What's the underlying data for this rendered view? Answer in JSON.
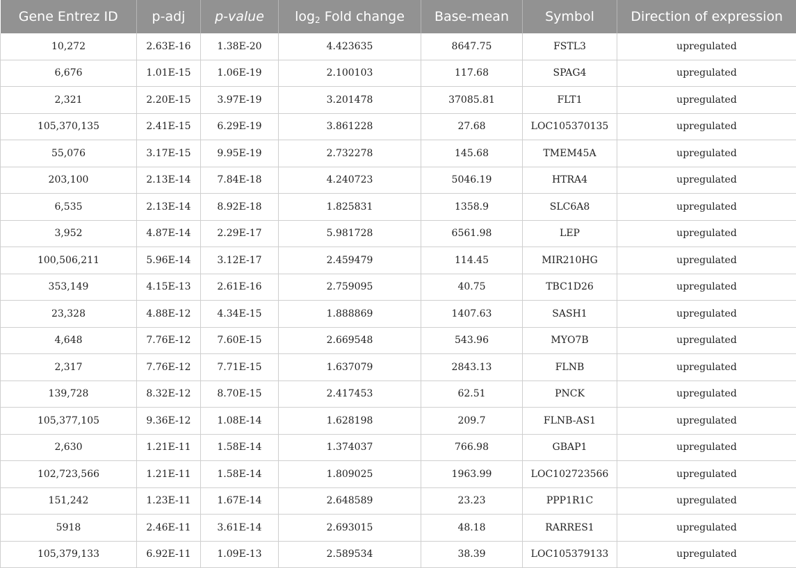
{
  "table": {
    "headers": {
      "gene_id": "Gene Entrez ID",
      "padj": "p-adj",
      "pvalue": "p-value",
      "log_prefix": "log",
      "log_sub": "2",
      "log_suffix": " Fold change",
      "basemean": "Base-mean",
      "symbol": "Symbol",
      "direction": "Direction of expression"
    },
    "rows": [
      [
        "10,272",
        "2.63E-16",
        "1.38E-20",
        "4.423635",
        "8647.75",
        "FSTL3",
        "upregulated"
      ],
      [
        "6,676",
        "1.01E-15",
        "1.06E-19",
        "2.100103",
        "117.68",
        "SPAG4",
        "upregulated"
      ],
      [
        "2,321",
        "2.20E-15",
        "3.97E-19",
        "3.201478",
        "37085.81",
        "FLT1",
        "upregulated"
      ],
      [
        "105,370,135",
        "2.41E-15",
        "6.29E-19",
        "3.861228",
        "27.68",
        "LOC105370135",
        "upregulated"
      ],
      [
        "55,076",
        "3.17E-15",
        "9.95E-19",
        "2.732278",
        "145.68",
        "TMEM45A",
        "upregulated"
      ],
      [
        "203,100",
        "2.13E-14",
        "7.84E-18",
        "4.240723",
        "5046.19",
        "HTRA4",
        "upregulated"
      ],
      [
        "6,535",
        "2.13E-14",
        "8.92E-18",
        "1.825831",
        "1358.9",
        "SLC6A8",
        "upregulated"
      ],
      [
        "3,952",
        "4.87E-14",
        "2.29E-17",
        "5.981728",
        "6561.98",
        "LEP",
        "upregulated"
      ],
      [
        "100,506,211",
        "5.96E-14",
        "3.12E-17",
        "2.459479",
        "114.45",
        "MIR210HG",
        "upregulated"
      ],
      [
        "353,149",
        "4.15E-13",
        "2.61E-16",
        "2.759095",
        "40.75",
        "TBC1D26",
        "upregulated"
      ],
      [
        "23,328",
        "4.88E-12",
        "4.34E-15",
        "1.888869",
        "1407.63",
        "SASH1",
        "upregulated"
      ],
      [
        "4,648",
        "7.76E-12",
        "7.60E-15",
        "2.669548",
        "543.96",
        "MYO7B",
        "upregulated"
      ],
      [
        "2,317",
        "7.76E-12",
        "7.71E-15",
        "1.637079",
        "2843.13",
        "FLNB",
        "upregulated"
      ],
      [
        "139,728",
        "8.32E-12",
        "8.70E-15",
        "2.417453",
        "62.51",
        "PNCK",
        "upregulated"
      ],
      [
        "105,377,105",
        "9.36E-12",
        "1.08E-14",
        "1.628198",
        "209.7",
        "FLNB-AS1",
        "upregulated"
      ],
      [
        "2,630",
        "1.21E-11",
        "1.58E-14",
        "1.374037",
        "766.98",
        "GBAP1",
        "upregulated"
      ],
      [
        "102,723,566",
        "1.21E-11",
        "1.58E-14",
        "1.809025",
        "1963.99",
        "LOC102723566",
        "upregulated"
      ],
      [
        "151,242",
        "1.23E-11",
        "1.67E-14",
        "2.648589",
        "23.23",
        "PPP1R1C",
        "upregulated"
      ],
      [
        "5918",
        "2.46E-11",
        "3.61E-14",
        "2.693015",
        "48.18",
        "RARRES1",
        "upregulated"
      ],
      [
        "105,379,133",
        "6.92E-11",
        "1.09E-13",
        "2.589534",
        "38.39",
        "LOC105379133",
        "upregulated"
      ]
    ]
  }
}
